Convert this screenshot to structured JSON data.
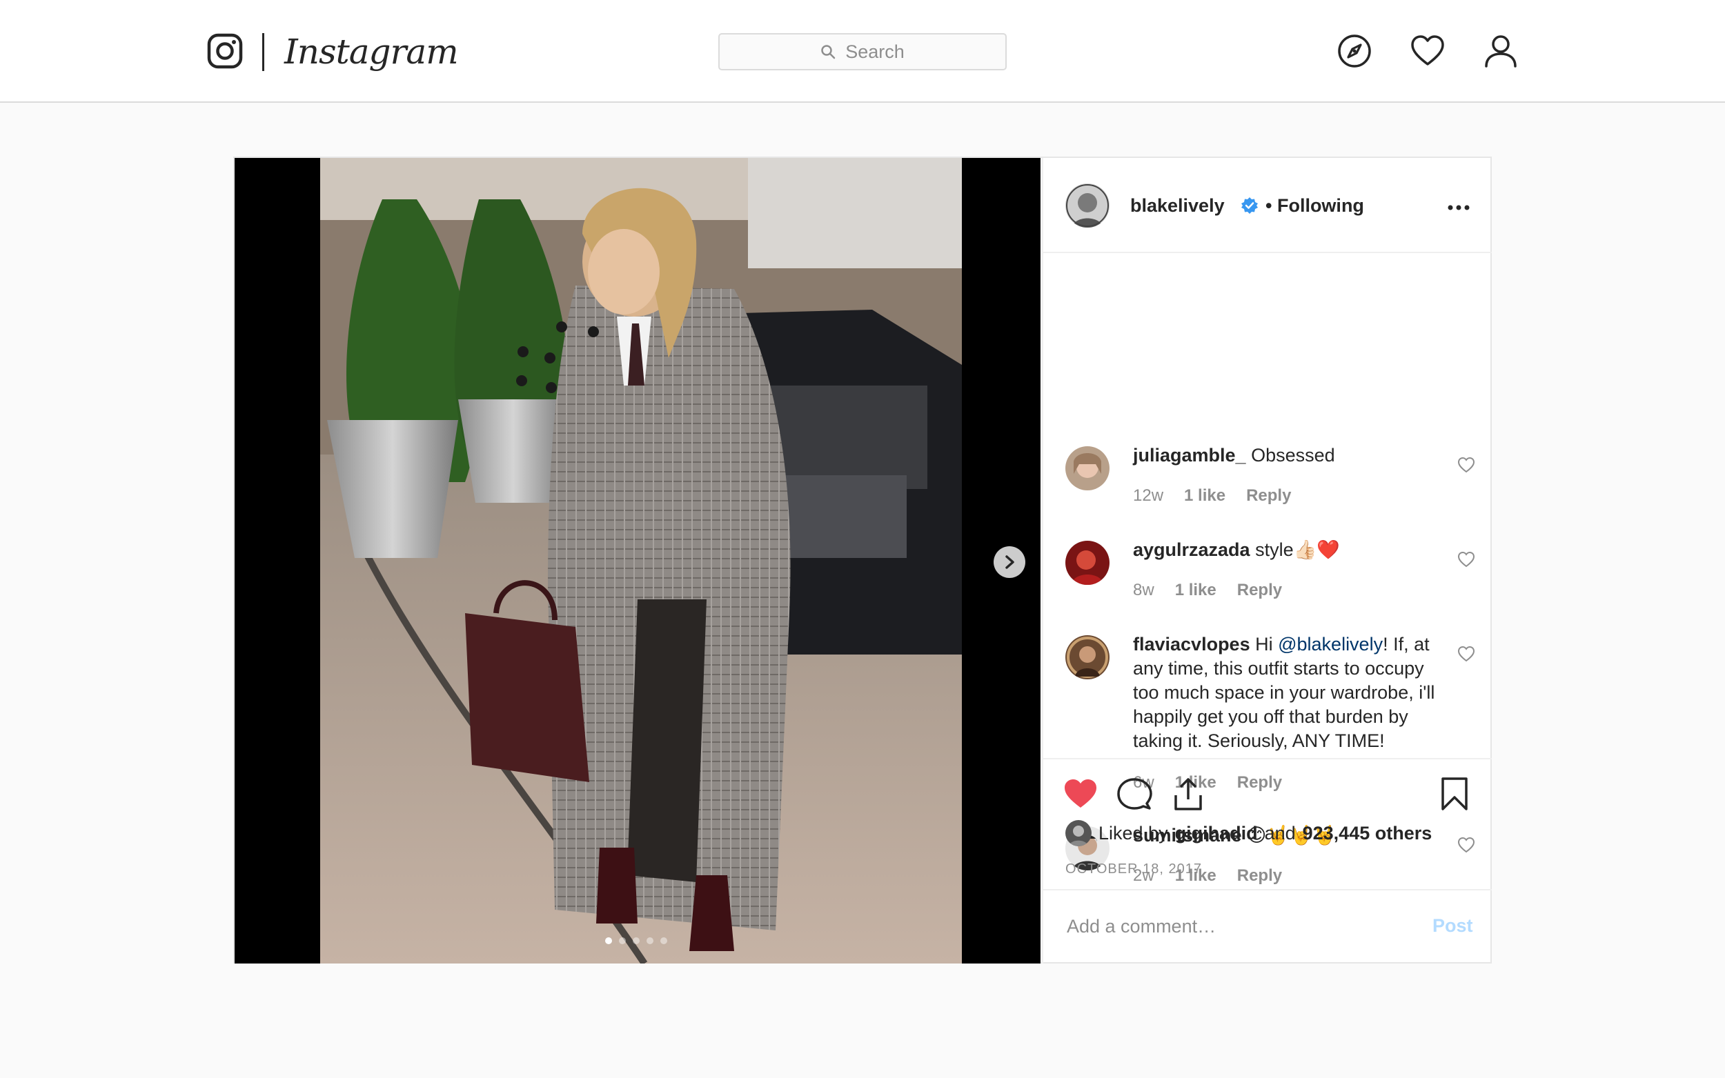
{
  "nav": {
    "brand": "Instagram",
    "search_placeholder": "Search",
    "icons": [
      "instagram-glyph-icon",
      "search-icon",
      "explore-compass-icon",
      "activity-heart-icon",
      "profile-person-icon"
    ]
  },
  "post": {
    "username": "blakelively",
    "follow_status": "• Following",
    "verified": true,
    "media": {
      "slide_count": 5,
      "active_slide": 1
    },
    "comments": [
      {
        "username": "juliagamble_",
        "text": "Obsessed",
        "age": "12w",
        "likes": "1 like",
        "reply": "Reply"
      },
      {
        "username": "aygulrzazada",
        "text": "style👍🏻❤️",
        "age": "8w",
        "likes": "1 like",
        "reply": "Reply"
      },
      {
        "username": "flaviacvlopes",
        "text_before": "Hi ",
        "mention": "@blakelively",
        "text_after": "! If, at any time, this outfit starts to occupy too much space in your wardrobe, i'll happily get you off that burden by taking it. Seriously, ANY TIME!",
        "age": "6w",
        "likes": "1 like",
        "reply": "Reply"
      },
      {
        "username": "sumitsmane",
        "text": "😊🤘🤘🤘",
        "age": "2w",
        "likes": "1 like",
        "reply": "Reply"
      }
    ],
    "liked_by_prefix": "Liked by",
    "liked_by_user": "gigihadid",
    "liked_by_mid": "and",
    "liked_by_others": "923,445 others",
    "date": "OCTOBER 18, 2017",
    "add_comment_placeholder": "Add a comment…",
    "post_button": "Post"
  },
  "colors": {
    "like_red": "#ed4956",
    "verified_blue": "#3897f0",
    "post_button_disabled": "#b3dbff",
    "mention": "#003569"
  }
}
